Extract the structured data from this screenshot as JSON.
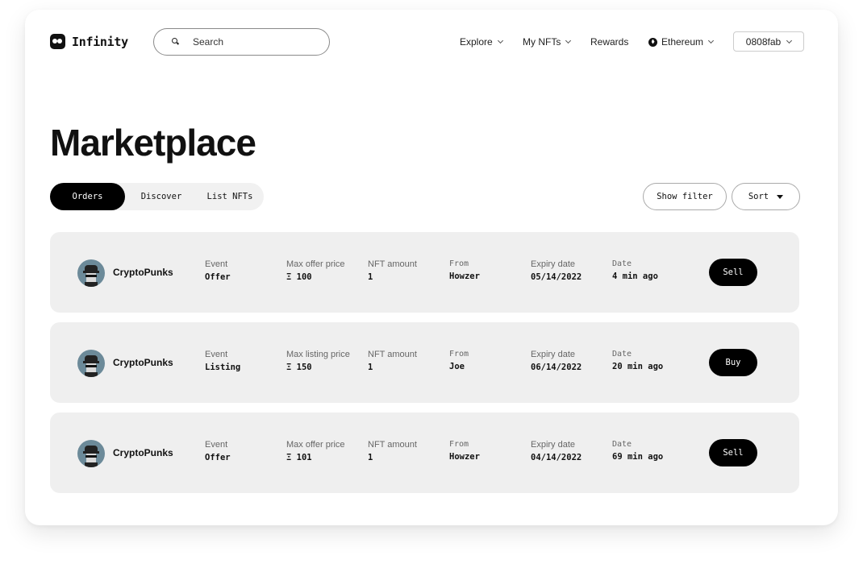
{
  "header": {
    "logo_text": "Infinity",
    "search_placeholder": "Search",
    "nav": {
      "explore": "Explore",
      "my_nfts": "My NFTs",
      "rewards": "Rewards",
      "network": "Ethereum"
    },
    "wallet": "0808fab"
  },
  "page_title": "Marketplace",
  "tabs": [
    "Orders",
    "Discover",
    "List NFTs"
  ],
  "active_tab": "Orders",
  "controls": {
    "show_filter": "Show filter",
    "sort": "Sort"
  },
  "orders": [
    {
      "collection": "CryptoPunks",
      "event_label": "Event",
      "event": "Offer",
      "price_label": "Max offer price",
      "price": "Ξ 100",
      "amount_label": "NFT amount",
      "amount": "1",
      "from_label": "From",
      "from": "Howzer",
      "expiry_label": "Expiry date",
      "expiry": "05/14/2022",
      "date_label": "Date",
      "date": "4 min ago",
      "action": "Sell"
    },
    {
      "collection": "CryptoPunks",
      "event_label": "Event",
      "event": "Listing",
      "price_label": "Max listing price",
      "price": "Ξ 150",
      "amount_label": "NFT amount",
      "amount": "1",
      "from_label": "From",
      "from": "Joe",
      "expiry_label": "Expiry date",
      "expiry": "06/14/2022",
      "date_label": "Date",
      "date": "20 min ago",
      "action": "Buy"
    },
    {
      "collection": "CryptoPunks",
      "event_label": "Event",
      "event": "Offer",
      "price_label": "Max offer price",
      "price": "Ξ 101",
      "amount_label": "NFT amount",
      "amount": "1",
      "from_label": "From",
      "from": "Howzer",
      "expiry_label": "Expiry date",
      "expiry": "04/14/2022",
      "date_label": "Date",
      "date": "69 min ago",
      "action": "Sell"
    }
  ]
}
